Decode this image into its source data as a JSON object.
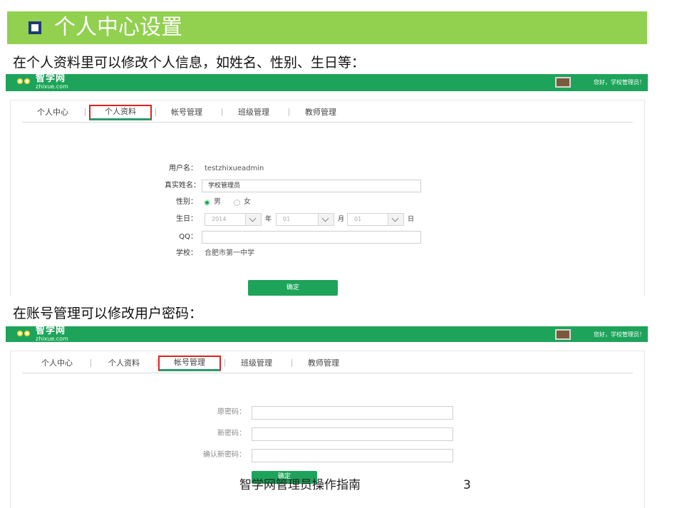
{
  "slide": {
    "title": "个人中心设置",
    "caption1": "在个人资料里可以修改个人信息，如姓名、性别、生日等：",
    "caption2": "在账号管理可以修改用户密码：",
    "footer": "智学网管理员操作指南",
    "page_number": "3"
  },
  "app": {
    "brand": "智学网",
    "domain": "zhixue.com",
    "greeting": "您好，学校管理员！",
    "accent_color": "#1ea35a",
    "highlight_color": "#e02020"
  },
  "tabs": [
    "个人中心",
    "个人资料",
    "帐号管理",
    "班级管理",
    "教师管理"
  ],
  "profile_form": {
    "active_tab": "个人资料",
    "username_label": "用户名：",
    "username_value": "testzhixueadmin",
    "realname_label": "真实姓名：",
    "realname_value": "学校管理员",
    "gender_label": "性别：",
    "gender_male": "男",
    "gender_female": "女",
    "gender_selected": "男",
    "birthday_label": "生日：",
    "birth_year": "2014",
    "year_unit": "年",
    "birth_month": "01",
    "month_unit": "月",
    "birth_day": "01",
    "day_unit": "日",
    "qq_label": "QQ：",
    "qq_value": "",
    "school_label": "学校：",
    "school_value": "合肥市第一中学",
    "submit_label": "确定"
  },
  "password_form": {
    "active_tab": "帐号管理",
    "old_password_label": "原密码：",
    "new_password_label": "新密码：",
    "confirm_password_label": "确认新密码：",
    "submit_label": "确定"
  }
}
